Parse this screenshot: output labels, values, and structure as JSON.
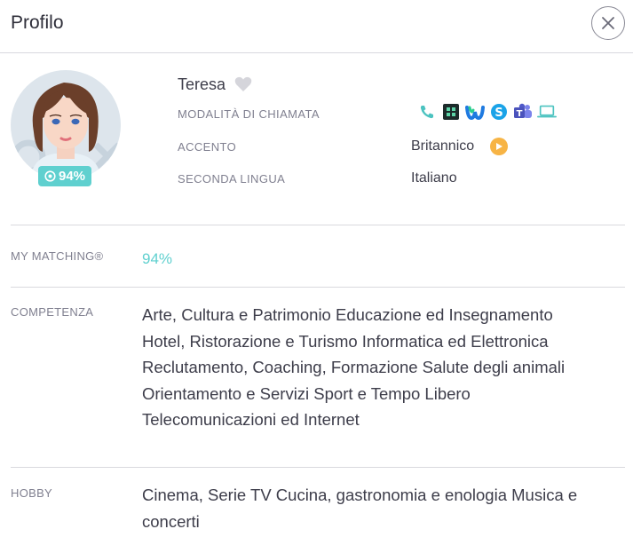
{
  "header": {
    "title": "Profilo"
  },
  "profile": {
    "name": "Teresa",
    "match_badge": "94%",
    "call_mode_label": "MODALITÀ DI CHIAMATA",
    "call_icons": [
      "phone-icon",
      "zoom-app-icon",
      "webex-icon",
      "skype-icon",
      "teams-icon",
      "laptop-icon"
    ],
    "accent_label": "ACCENTO",
    "accent_value": "Britannico",
    "second_language_label": "SECONDA LINGUA",
    "second_language_value": "Italiano"
  },
  "matching": {
    "label": "MY MATCHING®",
    "value": "94%"
  },
  "competenza": {
    "label": "COMPETENZA",
    "lines": [
      "Arte, Cultura e Patrimonio Educazione ed Insegnamento",
      "Hotel, Ristorazione e Turismo Informatica ed Elettronica",
      "Reclutamento, Coaching, Formazione Salute degli animali",
      "Orientamento e Servizi Sport e Tempo Libero",
      "Telecomunicazioni ed Internet"
    ]
  },
  "hobby": {
    "label": "HOBBY",
    "lines": [
      "Cinema, Serie TV Cucina, gastronomia e enologia Musica e",
      "concerti"
    ]
  },
  "colors": {
    "accent": "#5fd0cf",
    "audio": "#f7b445",
    "text": "#3d3d4a",
    "muted": "#808090"
  }
}
